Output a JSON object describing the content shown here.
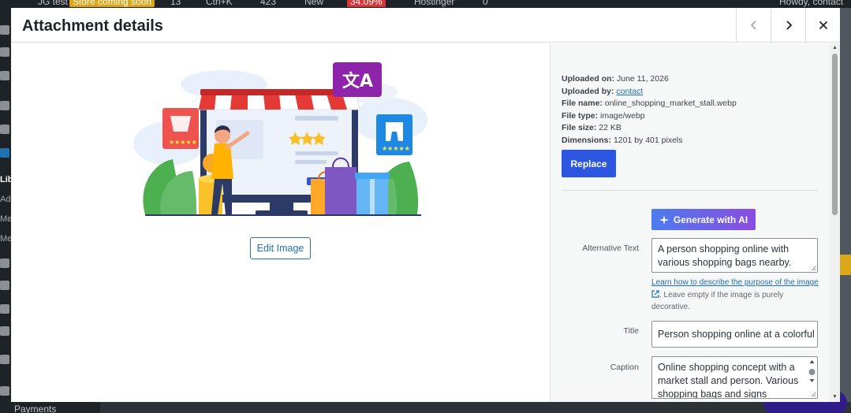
{
  "background": {
    "adminbar": {
      "site": "JG test",
      "store_badge": "Store coming soon",
      "updates": "13",
      "search_hint": "Ctrl+K",
      "comments": "423",
      "new": "New",
      "percent": "34.09%",
      "hostinger": "Hostinger",
      "notifications": "0",
      "greeting": "Howdy, contact"
    },
    "menu": {
      "lib": "Lib",
      "ad": "Ad",
      "me1": "Me",
      "me2": "Me",
      "payments": "Payments"
    }
  },
  "modal": {
    "title": "Attachment details",
    "prev_icon": "chevron-left-icon",
    "next_icon": "chevron-right-icon",
    "close_icon": "close-icon",
    "edit_image_label": "Edit Image",
    "illustration": "online-shopping-market-stall-illustration",
    "meta": {
      "uploaded_on_label": "Uploaded on:",
      "uploaded_on": "June 11, 2026",
      "uploaded_by_label": "Uploaded by:",
      "uploaded_by": "contact",
      "file_name_label": "File name:",
      "file_name": "online_shopping_market_stall.webp",
      "file_type_label": "File type:",
      "file_type": "image/webp",
      "file_size_label": "File size:",
      "file_size": "22 KB",
      "dimensions_label": "Dimensions:",
      "dimensions": "1201 by 401 pixels"
    },
    "replace_label": "Replace",
    "ai_button_label": "Generate with AI",
    "alt_text": {
      "label": "Alternative Text",
      "value": "A person shopping online with various shopping bags nearby."
    },
    "help": {
      "link": "Learn how to describe the purpose of the image",
      "text": ". Leave empty if the image is purely decorative."
    },
    "title_field": {
      "label": "Title",
      "value": "Person shopping online at a colorful"
    },
    "caption": {
      "label": "Caption",
      "value": "Online shopping concept with a market stall and person. Various shopping bags and signs"
    }
  }
}
